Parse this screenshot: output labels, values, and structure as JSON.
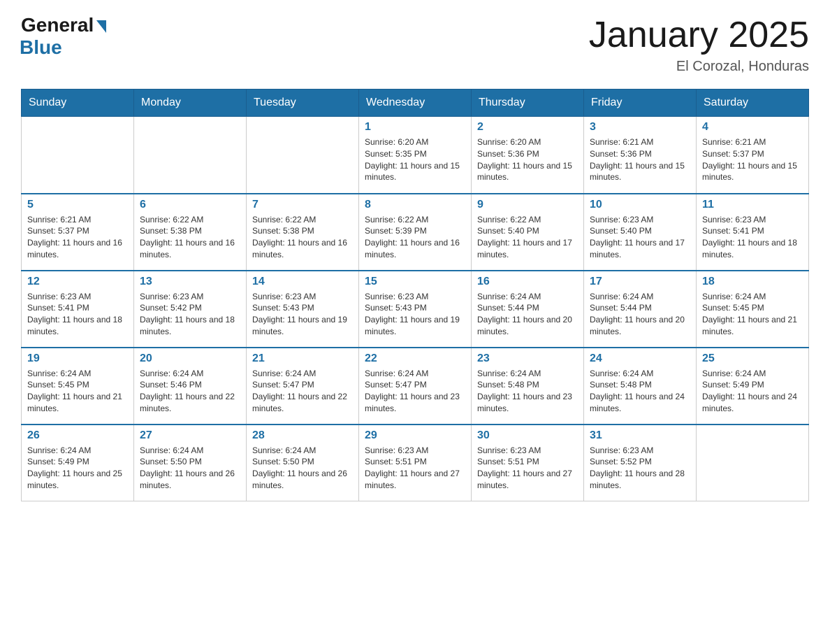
{
  "header": {
    "logo_general": "General",
    "logo_blue": "Blue",
    "title": "January 2025",
    "location": "El Corozal, Honduras"
  },
  "weekdays": [
    "Sunday",
    "Monday",
    "Tuesday",
    "Wednesday",
    "Thursday",
    "Friday",
    "Saturday"
  ],
  "weeks": [
    [
      {
        "day": "",
        "info": ""
      },
      {
        "day": "",
        "info": ""
      },
      {
        "day": "",
        "info": ""
      },
      {
        "day": "1",
        "info": "Sunrise: 6:20 AM\nSunset: 5:35 PM\nDaylight: 11 hours and 15 minutes."
      },
      {
        "day": "2",
        "info": "Sunrise: 6:20 AM\nSunset: 5:36 PM\nDaylight: 11 hours and 15 minutes."
      },
      {
        "day": "3",
        "info": "Sunrise: 6:21 AM\nSunset: 5:36 PM\nDaylight: 11 hours and 15 minutes."
      },
      {
        "day": "4",
        "info": "Sunrise: 6:21 AM\nSunset: 5:37 PM\nDaylight: 11 hours and 15 minutes."
      }
    ],
    [
      {
        "day": "5",
        "info": "Sunrise: 6:21 AM\nSunset: 5:37 PM\nDaylight: 11 hours and 16 minutes."
      },
      {
        "day": "6",
        "info": "Sunrise: 6:22 AM\nSunset: 5:38 PM\nDaylight: 11 hours and 16 minutes."
      },
      {
        "day": "7",
        "info": "Sunrise: 6:22 AM\nSunset: 5:38 PM\nDaylight: 11 hours and 16 minutes."
      },
      {
        "day": "8",
        "info": "Sunrise: 6:22 AM\nSunset: 5:39 PM\nDaylight: 11 hours and 16 minutes."
      },
      {
        "day": "9",
        "info": "Sunrise: 6:22 AM\nSunset: 5:40 PM\nDaylight: 11 hours and 17 minutes."
      },
      {
        "day": "10",
        "info": "Sunrise: 6:23 AM\nSunset: 5:40 PM\nDaylight: 11 hours and 17 minutes."
      },
      {
        "day": "11",
        "info": "Sunrise: 6:23 AM\nSunset: 5:41 PM\nDaylight: 11 hours and 18 minutes."
      }
    ],
    [
      {
        "day": "12",
        "info": "Sunrise: 6:23 AM\nSunset: 5:41 PM\nDaylight: 11 hours and 18 minutes."
      },
      {
        "day": "13",
        "info": "Sunrise: 6:23 AM\nSunset: 5:42 PM\nDaylight: 11 hours and 18 minutes."
      },
      {
        "day": "14",
        "info": "Sunrise: 6:23 AM\nSunset: 5:43 PM\nDaylight: 11 hours and 19 minutes."
      },
      {
        "day": "15",
        "info": "Sunrise: 6:23 AM\nSunset: 5:43 PM\nDaylight: 11 hours and 19 minutes."
      },
      {
        "day": "16",
        "info": "Sunrise: 6:24 AM\nSunset: 5:44 PM\nDaylight: 11 hours and 20 minutes."
      },
      {
        "day": "17",
        "info": "Sunrise: 6:24 AM\nSunset: 5:44 PM\nDaylight: 11 hours and 20 minutes."
      },
      {
        "day": "18",
        "info": "Sunrise: 6:24 AM\nSunset: 5:45 PM\nDaylight: 11 hours and 21 minutes."
      }
    ],
    [
      {
        "day": "19",
        "info": "Sunrise: 6:24 AM\nSunset: 5:45 PM\nDaylight: 11 hours and 21 minutes."
      },
      {
        "day": "20",
        "info": "Sunrise: 6:24 AM\nSunset: 5:46 PM\nDaylight: 11 hours and 22 minutes."
      },
      {
        "day": "21",
        "info": "Sunrise: 6:24 AM\nSunset: 5:47 PM\nDaylight: 11 hours and 22 minutes."
      },
      {
        "day": "22",
        "info": "Sunrise: 6:24 AM\nSunset: 5:47 PM\nDaylight: 11 hours and 23 minutes."
      },
      {
        "day": "23",
        "info": "Sunrise: 6:24 AM\nSunset: 5:48 PM\nDaylight: 11 hours and 23 minutes."
      },
      {
        "day": "24",
        "info": "Sunrise: 6:24 AM\nSunset: 5:48 PM\nDaylight: 11 hours and 24 minutes."
      },
      {
        "day": "25",
        "info": "Sunrise: 6:24 AM\nSunset: 5:49 PM\nDaylight: 11 hours and 24 minutes."
      }
    ],
    [
      {
        "day": "26",
        "info": "Sunrise: 6:24 AM\nSunset: 5:49 PM\nDaylight: 11 hours and 25 minutes."
      },
      {
        "day": "27",
        "info": "Sunrise: 6:24 AM\nSunset: 5:50 PM\nDaylight: 11 hours and 26 minutes."
      },
      {
        "day": "28",
        "info": "Sunrise: 6:24 AM\nSunset: 5:50 PM\nDaylight: 11 hours and 26 minutes."
      },
      {
        "day": "29",
        "info": "Sunrise: 6:23 AM\nSunset: 5:51 PM\nDaylight: 11 hours and 27 minutes."
      },
      {
        "day": "30",
        "info": "Sunrise: 6:23 AM\nSunset: 5:51 PM\nDaylight: 11 hours and 27 minutes."
      },
      {
        "day": "31",
        "info": "Sunrise: 6:23 AM\nSunset: 5:52 PM\nDaylight: 11 hours and 28 minutes."
      },
      {
        "day": "",
        "info": ""
      }
    ]
  ]
}
